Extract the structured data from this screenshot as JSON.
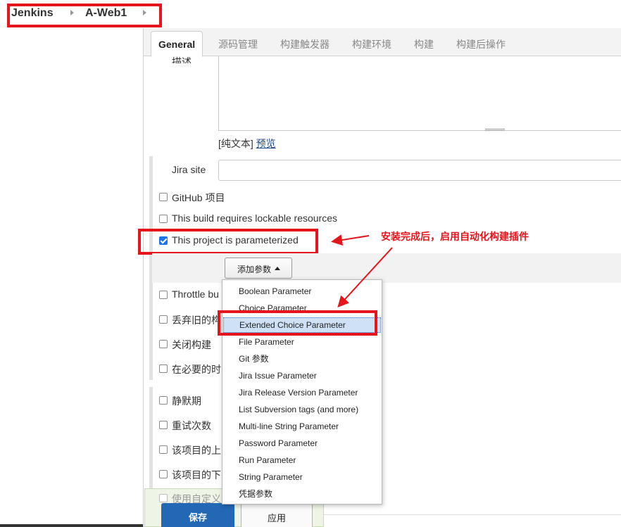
{
  "breadcrumb": {
    "items": [
      {
        "label": "Jenkins"
      },
      {
        "label": "A-Web1"
      }
    ]
  },
  "tabs": [
    {
      "label": "General",
      "active": true
    },
    {
      "label": "源码管理",
      "active": false
    },
    {
      "label": "构建触发器",
      "active": false
    },
    {
      "label": "构建环境",
      "active": false
    },
    {
      "label": "构建",
      "active": false
    },
    {
      "label": "构建后操作",
      "active": false
    }
  ],
  "description": {
    "label": "描述",
    "value": "",
    "plain_text_prefix": "[纯文本]",
    "preview_link": "预览"
  },
  "jira_site": {
    "label": "Jira site",
    "value": ""
  },
  "options": {
    "github_project": {
      "label": "GitHub 项目",
      "checked": false
    },
    "lockable": {
      "label": "This build requires lockable resources",
      "checked": false
    },
    "parameterized": {
      "label": "This project is parameterized",
      "checked": true
    },
    "throttle": {
      "label": "Throttle bu",
      "checked": false
    },
    "discard_old": {
      "label": "丢弃旧的构",
      "checked": false
    },
    "disable_build": {
      "label": "关闭构建",
      "checked": false
    },
    "concurrent": {
      "label": "在必要的时",
      "checked": false
    },
    "quiet_period": {
      "label": "静默期",
      "checked": false
    },
    "retry_count": {
      "label": "重试次数",
      "checked": false
    },
    "block_upstream": {
      "label": "该项目的上",
      "checked": false
    },
    "block_downstream": {
      "label": "该项目的下",
      "checked": false
    },
    "custom_workspace": {
      "label": "使用自定义",
      "checked": false
    }
  },
  "add_parameter": {
    "label": "添加参数"
  },
  "parameter_menu": {
    "highlighted_index": 2,
    "items": [
      "Boolean Parameter",
      "Choice Parameter",
      "Extended Choice Parameter",
      "File Parameter",
      "Git 参数",
      "Jira Issue Parameter",
      "Jira Release Version Parameter",
      "List Subversion tags (and more)",
      "Multi-line String Parameter",
      "Password Parameter",
      "Run Parameter",
      "String Parameter",
      "凭据参数"
    ]
  },
  "annotation": {
    "text": "安装完成后，启用自动化构建插件",
    "color": "#e8141c"
  },
  "footer": {
    "save_label": "保存",
    "apply_label": "应用"
  },
  "colors": {
    "accent_red": "#e8141c",
    "primary_blue": "#2268b4",
    "checkbox_blue": "#1e73e8",
    "menu_highlight": "#cfe1f7"
  }
}
